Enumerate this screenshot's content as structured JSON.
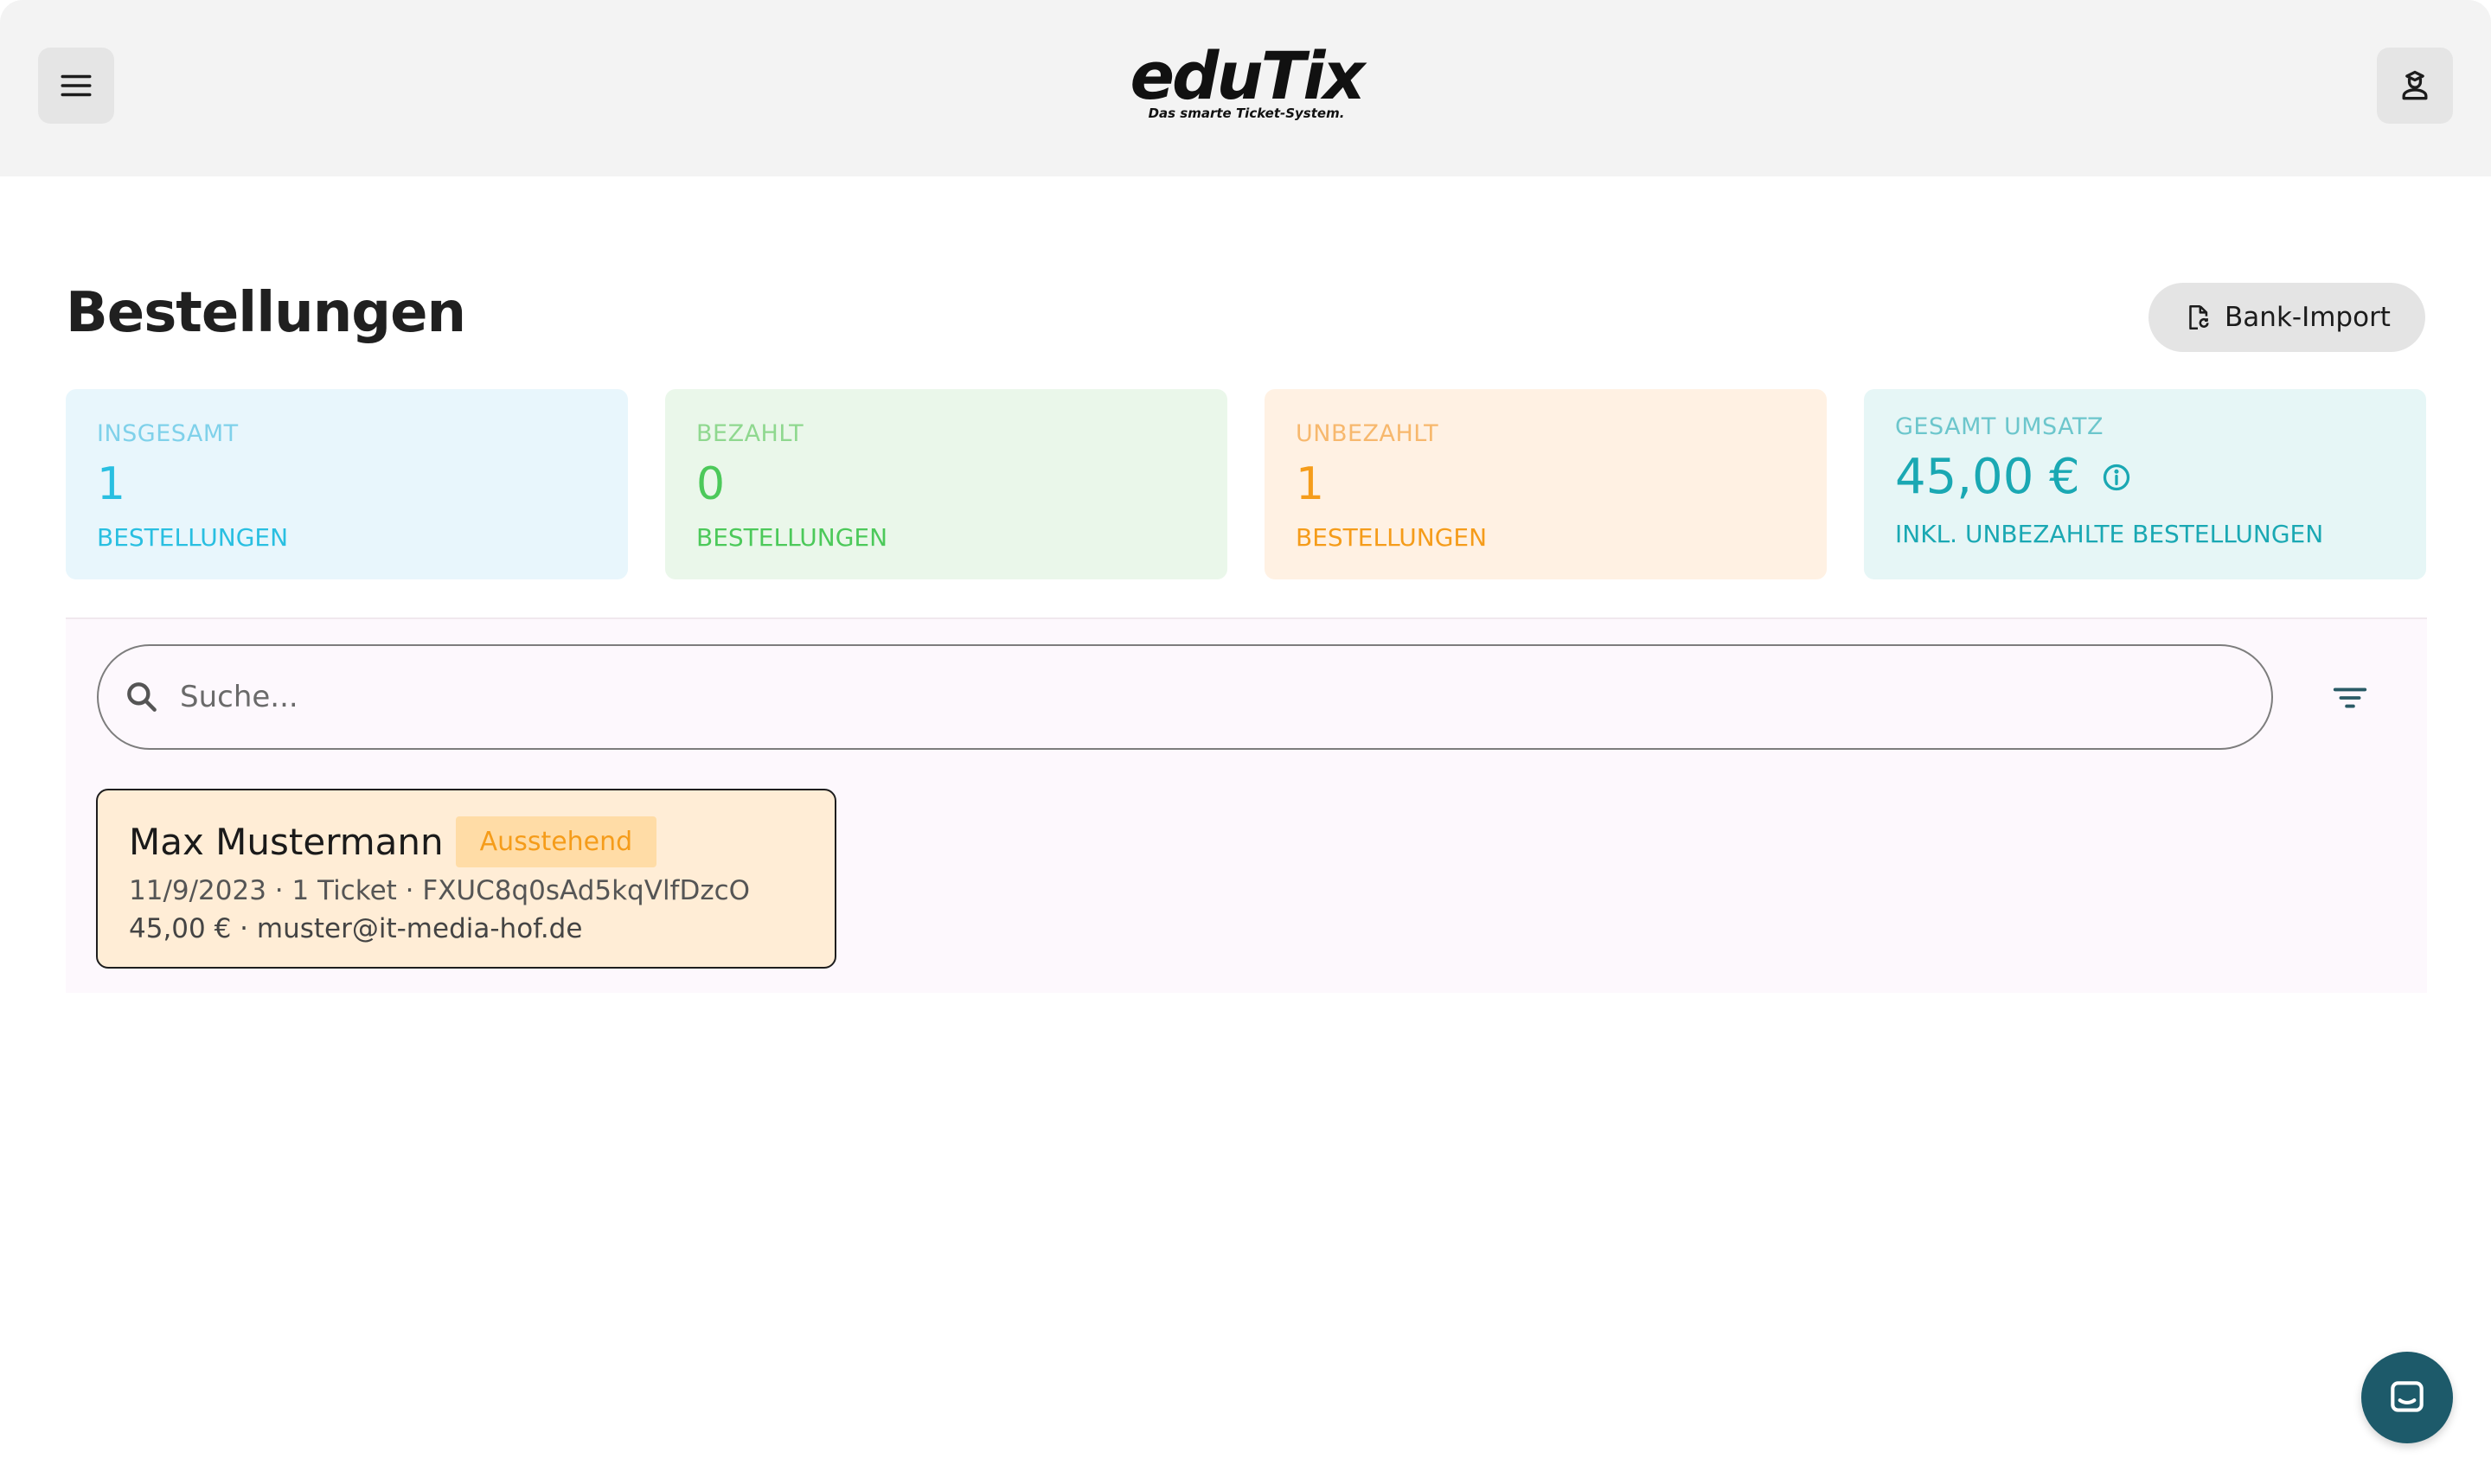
{
  "header": {
    "logo_text": "eduTix",
    "logo_tagline": "Das smarte Ticket-System.",
    "menu_icon": "menu-icon",
    "profile_icon": "user-icon"
  },
  "page": {
    "title": "Bestellungen",
    "bank_import_label": "Bank-Import",
    "bank_import_icon": "file-sync-icon"
  },
  "stats": [
    {
      "label": "INSGESAMT",
      "value": "1",
      "sub": "BESTELLUNGEN",
      "color": "#29bfe1"
    },
    {
      "label": "BEZAHLT",
      "value": "0",
      "sub": "BESTELLUNGEN",
      "color": "#4cc95a"
    },
    {
      "label": "UNBEZAHLT",
      "value": "1",
      "sub": "BESTELLUNGEN",
      "color": "#f59c1a"
    },
    {
      "label": "GESAMT UMSATZ",
      "value": "45,00 €",
      "sub": "INKL. UNBEZAHLTE BESTELLUNGEN",
      "color": "#1aa8b3",
      "info_icon": "info-icon"
    }
  ],
  "search": {
    "placeholder": "Suche...",
    "value": "",
    "icon": "search-icon",
    "filter_icon": "filter-icon"
  },
  "orders": [
    {
      "name": "Max Mustermann",
      "status": "Ausstehend",
      "date": "11/9/2023",
      "tickets": "1 Ticket",
      "code": "FXUC8q0sAd5kqVlfDzcO",
      "amount": "45,00 €",
      "email": "muster@it-media-hof.de",
      "line1": "11/9/2023 · 1 Ticket · FXUC8q0sAd5kqVlfDzcO",
      "line2": "45,00 € · muster@it-media-hof.de"
    }
  ],
  "chat": {
    "icon": "chat-icon"
  }
}
